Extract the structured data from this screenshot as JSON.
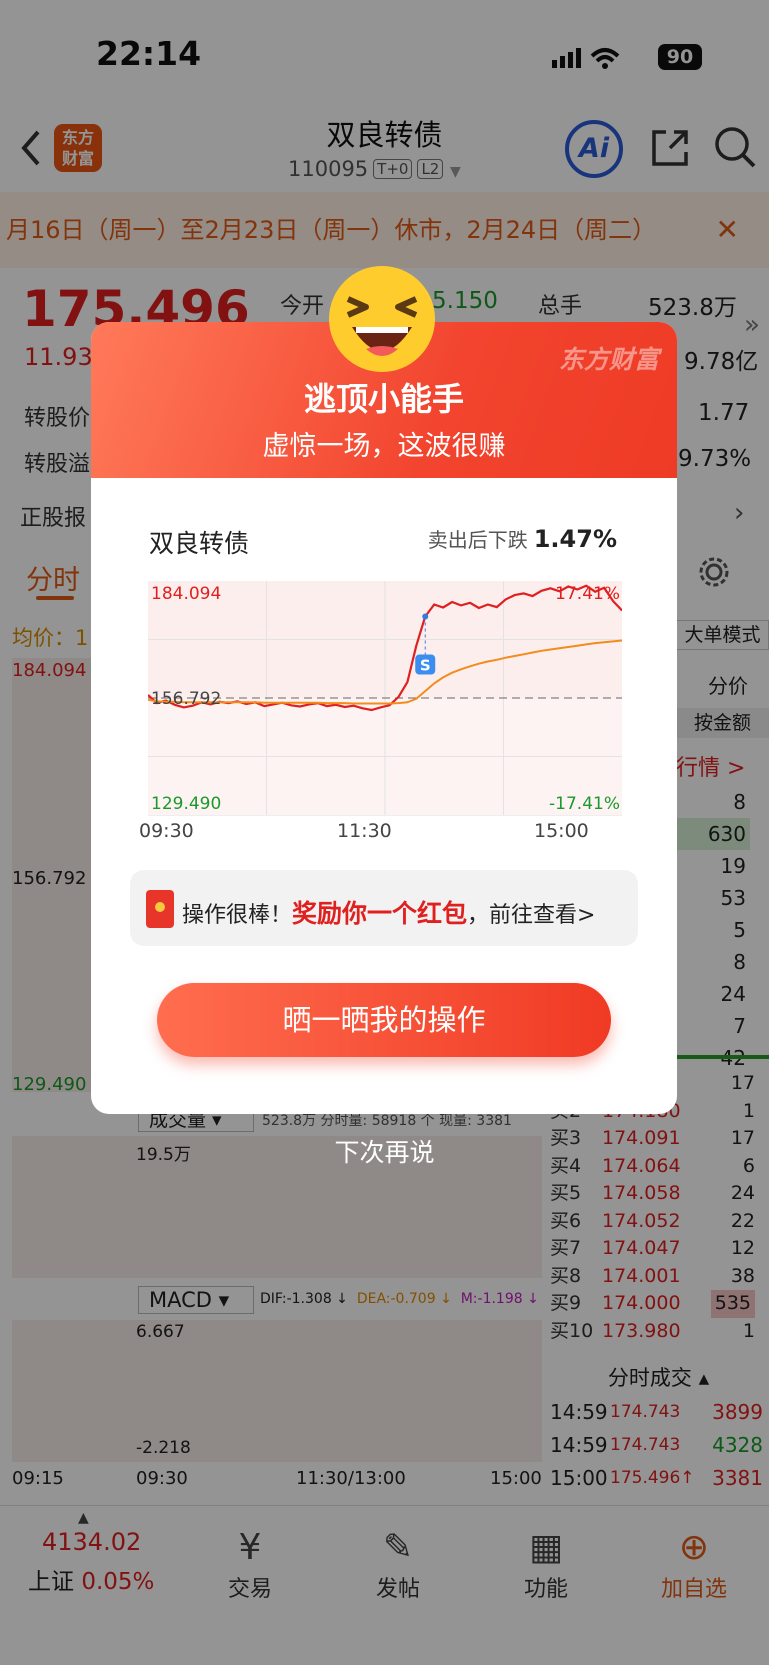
{
  "status_bar": {
    "time": "22:14",
    "battery": "90"
  },
  "header": {
    "title": "双良转债",
    "code": "110095",
    "tag1": "T+0",
    "tag2": "L2",
    "logo_line1": "东方",
    "logo_line2": "财富",
    "ai_label": "Ai"
  },
  "notice": {
    "text": "月16日（周一）至2月23日（周一）休市，2月24日（周二）",
    "close": "✕"
  },
  "quote": {
    "price": "175.496",
    "change_pct": "11.93",
    "open_label": "今开",
    "open_value": "5.150",
    "volume_label": "总手",
    "volume_value": "523.8万",
    "amount_value": "9.78亿",
    "conv_price_label": "转股价",
    "conv_value_label": "转股溢",
    "conv_price_value": "1.77",
    "conv_premium_value": "9.73%",
    "stock_label": "正股报"
  },
  "tabs": {
    "active": "分时",
    "avg_label": "均价：1"
  },
  "side_panel": {
    "mode": "大单模式",
    "unit": "分价",
    "amount_btn": "按金额",
    "more": "行情 >",
    "sell_sizes": [
      "8",
      "630",
      "19",
      "53",
      "5",
      "8",
      "24",
      "7",
      "42"
    ],
    "buy_rows": [
      {
        "label": "",
        "price": "",
        "size": "17"
      },
      {
        "label": "买2",
        "price": "174.180",
        "size": "1"
      },
      {
        "label": "买3",
        "price": "174.091",
        "size": "17"
      },
      {
        "label": "买4",
        "price": "174.064",
        "size": "6"
      },
      {
        "label": "买5",
        "price": "174.058",
        "size": "24"
      },
      {
        "label": "买6",
        "price": "174.052",
        "size": "22"
      },
      {
        "label": "买7",
        "price": "174.047",
        "size": "12"
      },
      {
        "label": "买8",
        "price": "174.001",
        "size": "38"
      },
      {
        "label": "买9",
        "price": "174.000",
        "size": "535"
      },
      {
        "label": "买10",
        "price": "173.980",
        "size": "1"
      }
    ],
    "ticks_title": "分时成交",
    "ticks": [
      {
        "time": "14:59",
        "price": "174.743",
        "vol": "3899"
      },
      {
        "time": "14:59",
        "price": "174.743",
        "vol": "4328"
      },
      {
        "time": "15:00",
        "price": "175.496↑",
        "vol": "3381"
      }
    ]
  },
  "main_chart": {
    "high": "184.094",
    "mid": "156.792",
    "low": "129.490"
  },
  "volume_panel": {
    "selector": "成交量",
    "info": "523.8万 分时量: 58918 个 现量: 3381",
    "scale": "19.5万"
  },
  "macd_panel": {
    "selector": "MACD",
    "dif": "DIF:-1.308 ↓",
    "dea": "DEA:-0.709 ↓",
    "m": "M:-1.198 ↓",
    "top": "6.667",
    "bottom": "-2.218"
  },
  "time_axis": [
    "09:15",
    "09:30",
    "11:30/13:00",
    "15:00"
  ],
  "modal": {
    "title": "逃顶小能手",
    "subtitle": "虚惊一场，这波很赚",
    "brand": "东方财富",
    "stock_name": "双良转债",
    "drop_label": "卖出后下跌",
    "drop_value": "1.47%",
    "reward_prefix": "操作很棒！",
    "reward_highlight": "奖励你一个红包",
    "reward_suffix": "，前往查看>",
    "cta": "晒一晒我的操作",
    "dismiss": "下次再说"
  },
  "chart_data": {
    "type": "line",
    "x_labels": [
      "09:30",
      "11:30",
      "15:00"
    ],
    "y_top_label": "184.094",
    "y_mid_label": "156.792",
    "y_bottom_label": "129.490",
    "pct_top_label": "17.41%",
    "pct_bottom_label": "-17.41%",
    "ylim": [
      129.49,
      184.094
    ],
    "baseline": 156.792,
    "series": [
      {
        "color": "#e0201f",
        "values": [
          157.5,
          155.6,
          156.2,
          155.2,
          154.6,
          155.0,
          155.8,
          155.3,
          155.9,
          155.6,
          156.0,
          155.4,
          155.8,
          154.9,
          155.3,
          155.7,
          155.1,
          154.8,
          155.3,
          155.6,
          154.9,
          155.2,
          154.7,
          155.0,
          154.4,
          154.0,
          154.6,
          155.1,
          157.0,
          160.5,
          169.0,
          175.8,
          178.6,
          177.9,
          179.2,
          178.4,
          179.0,
          177.8,
          178.6,
          178.0,
          179.8,
          180.8,
          181.2,
          180.6,
          181.8,
          182.4,
          181.7,
          182.8,
          182.1,
          183.0,
          181.6,
          182.5,
          179.4,
          177.2
        ]
      },
      {
        "color": "#f28c1c",
        "values": [
          156.4,
          156.0,
          155.9,
          155.9,
          155.8,
          155.8,
          155.8,
          155.8,
          155.8,
          155.8,
          155.8,
          155.8,
          155.8,
          155.7,
          155.7,
          155.7,
          155.7,
          155.7,
          155.7,
          155.7,
          155.6,
          155.6,
          155.6,
          155.5,
          155.5,
          155.5,
          155.5,
          155.5,
          155.6,
          155.8,
          156.6,
          158.4,
          160.2,
          161.6,
          162.7,
          163.5,
          164.2,
          164.8,
          165.3,
          165.7,
          166.2,
          166.6,
          167.0,
          167.4,
          167.8,
          168.1,
          168.4,
          168.7,
          169.0,
          169.3,
          169.6,
          169.8,
          170.0,
          170.2
        ]
      }
    ],
    "sell_marker": "S"
  }
}
